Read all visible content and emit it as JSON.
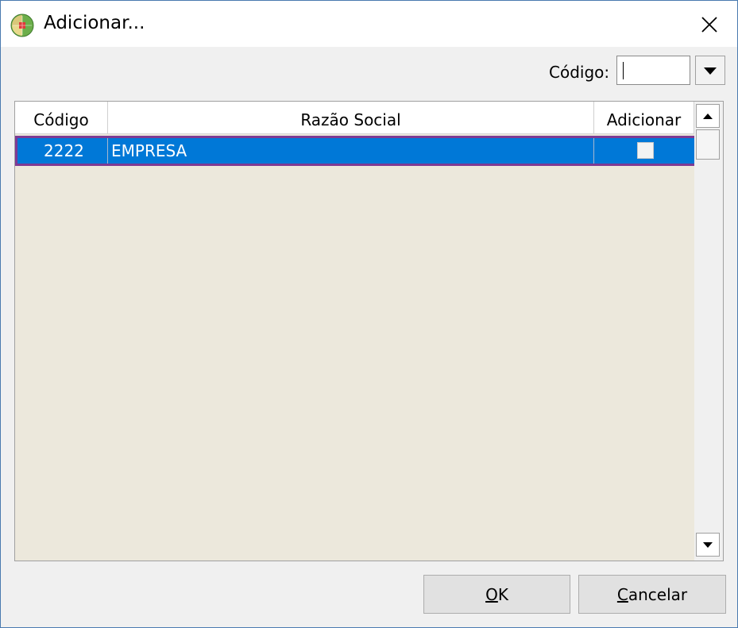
{
  "window": {
    "title": "Adicionar...",
    "icon": "app-globe-icon"
  },
  "filter": {
    "label": "Código:",
    "value": ""
  },
  "grid": {
    "columns": [
      "Código",
      "Razão Social",
      "Adicionar"
    ],
    "rows": [
      {
        "codigo": "2222",
        "razao_social": "EMPRESA",
        "adicionar": false
      }
    ],
    "selected_row": 0
  },
  "buttons": {
    "ok": "OK",
    "cancel": "Cancelar"
  },
  "colors": {
    "selection": "#0078d7",
    "selection_outline": "#7e3a94",
    "grid_background": "#ece8dc"
  }
}
